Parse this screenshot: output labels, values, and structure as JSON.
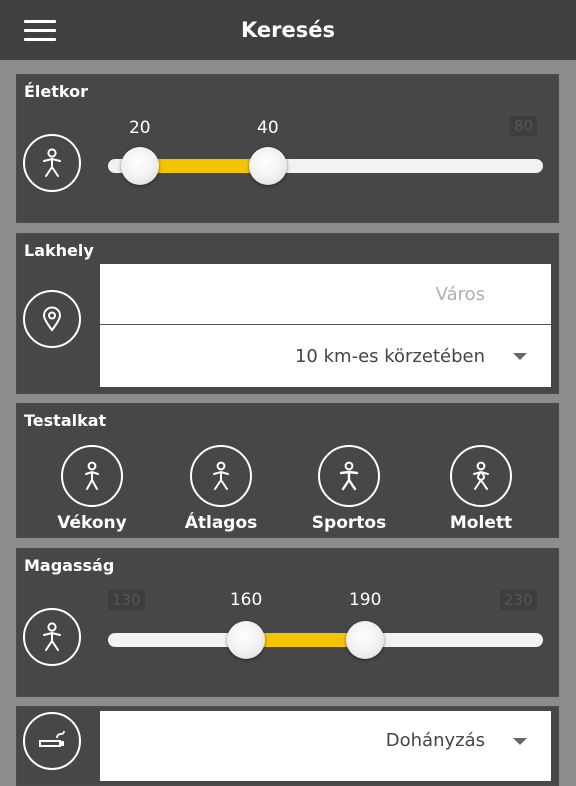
{
  "header": {
    "title": "Keresés",
    "menu_icon": "hamburger-menu-icon"
  },
  "age": {
    "title": "Életkor",
    "icon": "person-icon",
    "min": 18,
    "max": 80,
    "low": 20,
    "high": 40,
    "low_label": "20",
    "high_label": "40",
    "max_label": "80",
    "fill_color": "#f5c400"
  },
  "location": {
    "title": "Lakhely",
    "icon": "location-pin-icon",
    "city_placeholder": "Város",
    "radius_selected": "10 km-es körzetében"
  },
  "body_type": {
    "title": "Testalkat",
    "options": [
      {
        "label": "Vékony"
      },
      {
        "label": "Átlagos"
      },
      {
        "label": "Sportos"
      },
      {
        "label": "Molett"
      }
    ]
  },
  "height": {
    "title": "Magasság",
    "icon": "person-icon",
    "min": 130,
    "max": 230,
    "low": 160,
    "high": 190,
    "low_label": "160",
    "high_label": "190",
    "min_label": "130",
    "max_label": "230",
    "fill_color": "#f5c400"
  },
  "smoking": {
    "icon": "cigarette-icon",
    "selected": "Dohányzás"
  }
}
